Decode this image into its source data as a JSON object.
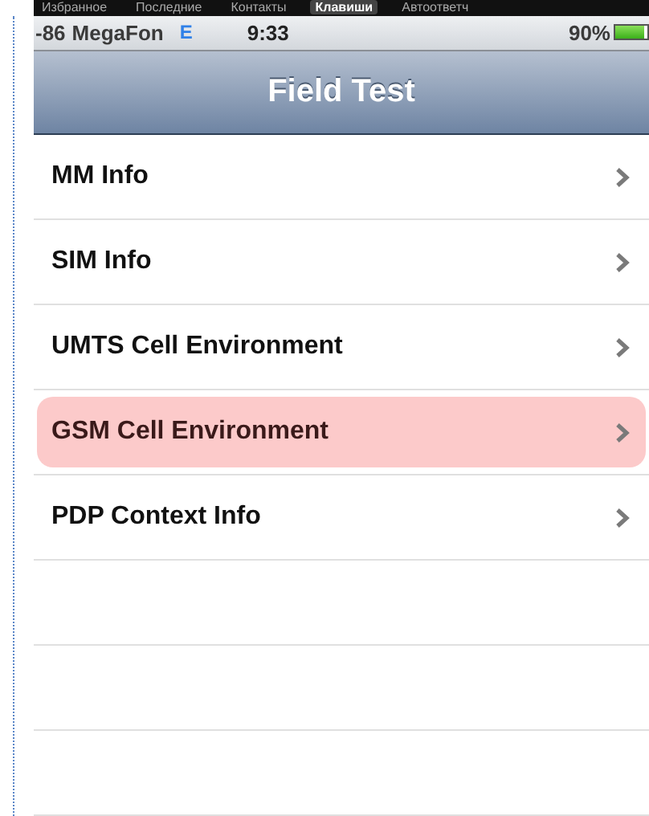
{
  "top_tabs": [
    {
      "label": "Избранное",
      "selected": false
    },
    {
      "label": "Последние",
      "selected": false
    },
    {
      "label": "Контакты",
      "selected": false
    },
    {
      "label": "Клавиши",
      "selected": true
    },
    {
      "label": "Автоответч",
      "selected": false
    }
  ],
  "status_bar": {
    "signal": "-86",
    "carrier": "MegaFon",
    "network": "E",
    "time": "9:33",
    "battery_text": "90%",
    "battery": {
      "level": 0.9
    }
  },
  "nav_bar": {
    "title": "Field Test"
  },
  "list": {
    "items": [
      {
        "label": "MM Info",
        "selected": false
      },
      {
        "label": "SIM Info",
        "selected": false
      },
      {
        "label": "UMTS Cell Environment",
        "selected": false
      },
      {
        "label": "GSM Cell Environment",
        "selected": true
      },
      {
        "label": "PDP Context Info",
        "selected": false
      }
    ]
  }
}
